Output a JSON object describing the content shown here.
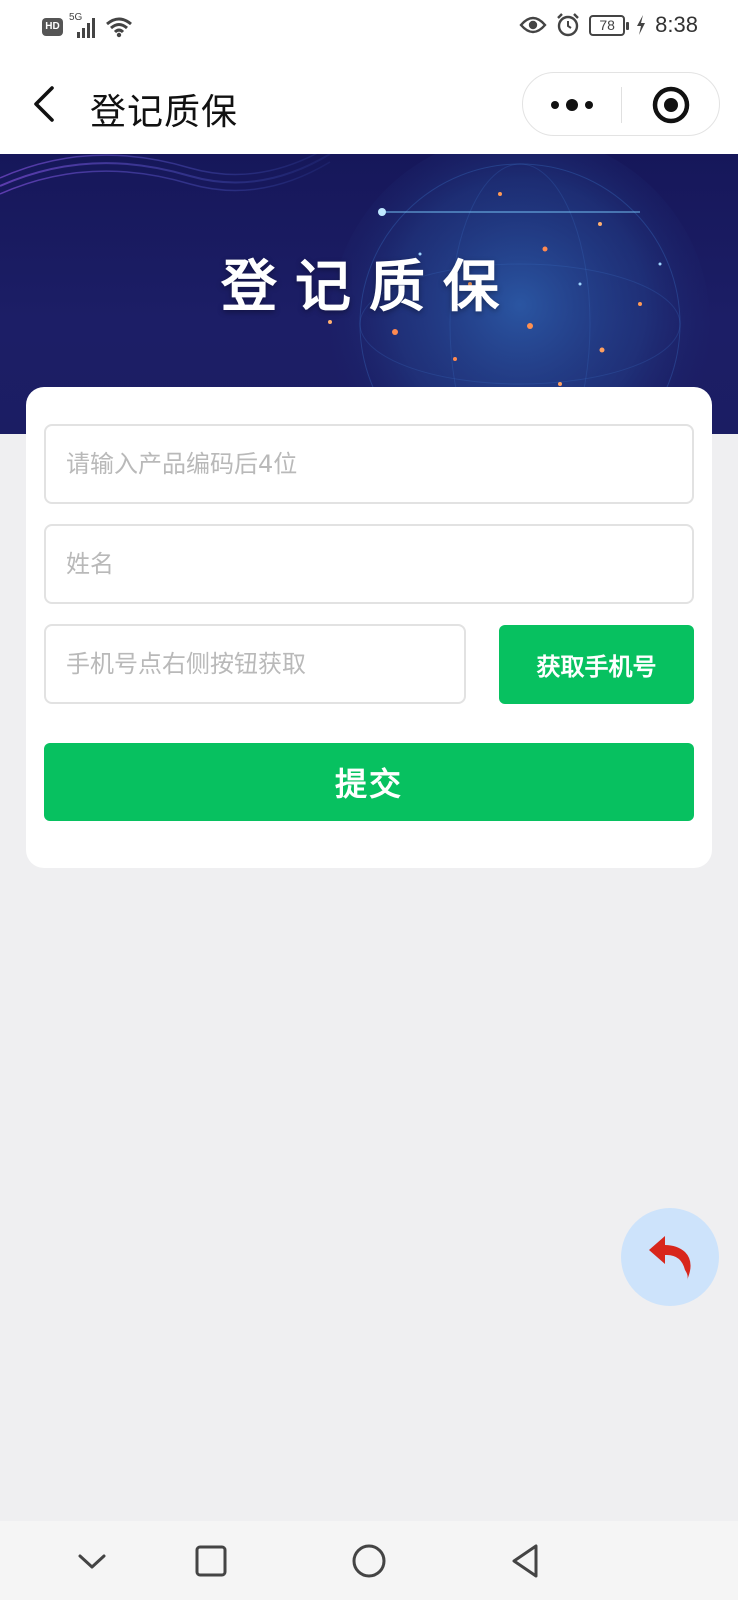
{
  "status_bar": {
    "hd_label": "HD",
    "network": "5G",
    "battery": "78",
    "time": "8:38"
  },
  "nav": {
    "title": "登记质保"
  },
  "banner": {
    "title": "登记质保"
  },
  "form": {
    "product_code_placeholder": "请输入产品编码后4位",
    "name_placeholder": "姓名",
    "phone_placeholder": "手机号点右侧按钮获取",
    "get_phone_label": "获取手机号",
    "submit_label": "提交"
  },
  "colors": {
    "accent_green": "#07c160",
    "banner_bg": "#1b1d63",
    "float_bg": "#cde3fb",
    "float_icon": "#d8261c"
  },
  "icons": {
    "back": "chevron-left-icon",
    "more": "more-dots-icon",
    "record": "record-target-icon",
    "float_back": "undo-arrow-icon"
  }
}
